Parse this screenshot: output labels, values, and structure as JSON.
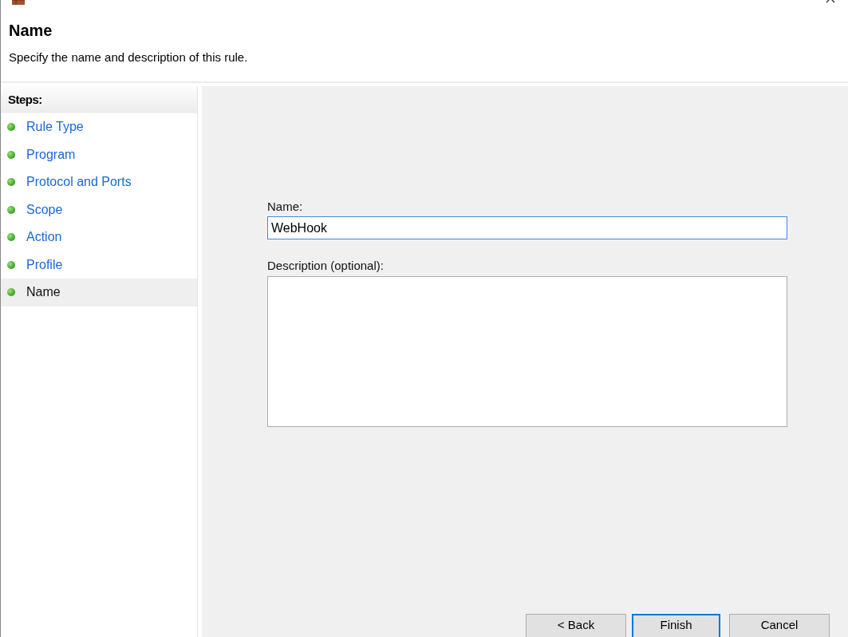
{
  "header": {
    "title": "Name",
    "subtitle": "Specify the name and description of this rule."
  },
  "steps": {
    "heading": "Steps:",
    "items": [
      {
        "label": "Rule Type",
        "selected": false
      },
      {
        "label": "Program",
        "selected": false
      },
      {
        "label": "Protocol and Ports",
        "selected": false
      },
      {
        "label": "Scope",
        "selected": false
      },
      {
        "label": "Action",
        "selected": false
      },
      {
        "label": "Profile",
        "selected": false
      },
      {
        "label": "Name",
        "selected": true
      }
    ]
  },
  "form": {
    "name_label": "Name:",
    "name_value": "WebHook",
    "description_label": "Description (optional):"
  },
  "buttons": [
    {
      "label": "< Back",
      "default": false
    },
    {
      "label": "Finish",
      "default": true
    },
    {
      "label": "Cancel",
      "default": false
    }
  ]
}
